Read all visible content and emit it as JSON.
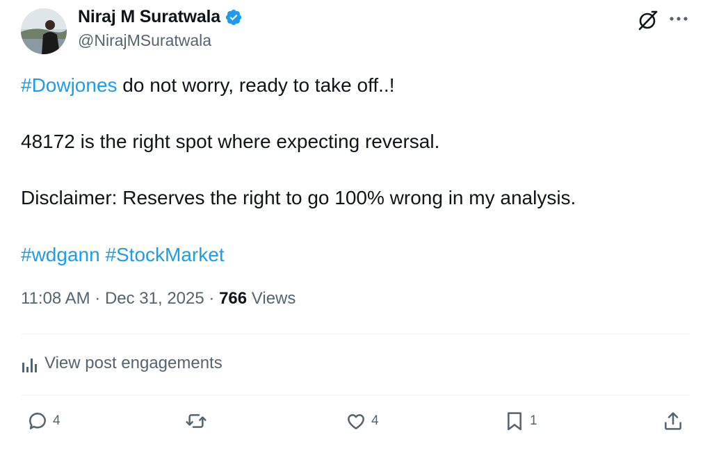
{
  "author": {
    "display_name": "Niraj M Suratwala",
    "handle": "@NirajMSuratwala"
  },
  "post": {
    "line1_hashtag": "#Dowjones",
    "line1_text": " do not worry, ready to take off..!",
    "line2": "48172 is the right spot where expecting reversal.",
    "line3": "Disclaimer: Reserves the right to go 100% wrong in my analysis.",
    "hashtags": [
      "#wdgann",
      "#StockMarket"
    ]
  },
  "meta": {
    "time": "11:08 AM",
    "date": "Dec 31, 2025",
    "views_count": "766",
    "views_label": "Views"
  },
  "engagements_label": "View post engagements",
  "actions": {
    "replies": "4",
    "likes": "4",
    "bookmarks": "1"
  },
  "colors": {
    "accent": "#1d9bf0",
    "text": "#0f1419",
    "muted": "#536471"
  },
  "icons": [
    "verified-badge-icon",
    "grok-icon",
    "more-icon",
    "bar-chart-icon",
    "reply-icon",
    "retweet-icon",
    "like-icon",
    "bookmark-icon",
    "share-icon"
  ]
}
